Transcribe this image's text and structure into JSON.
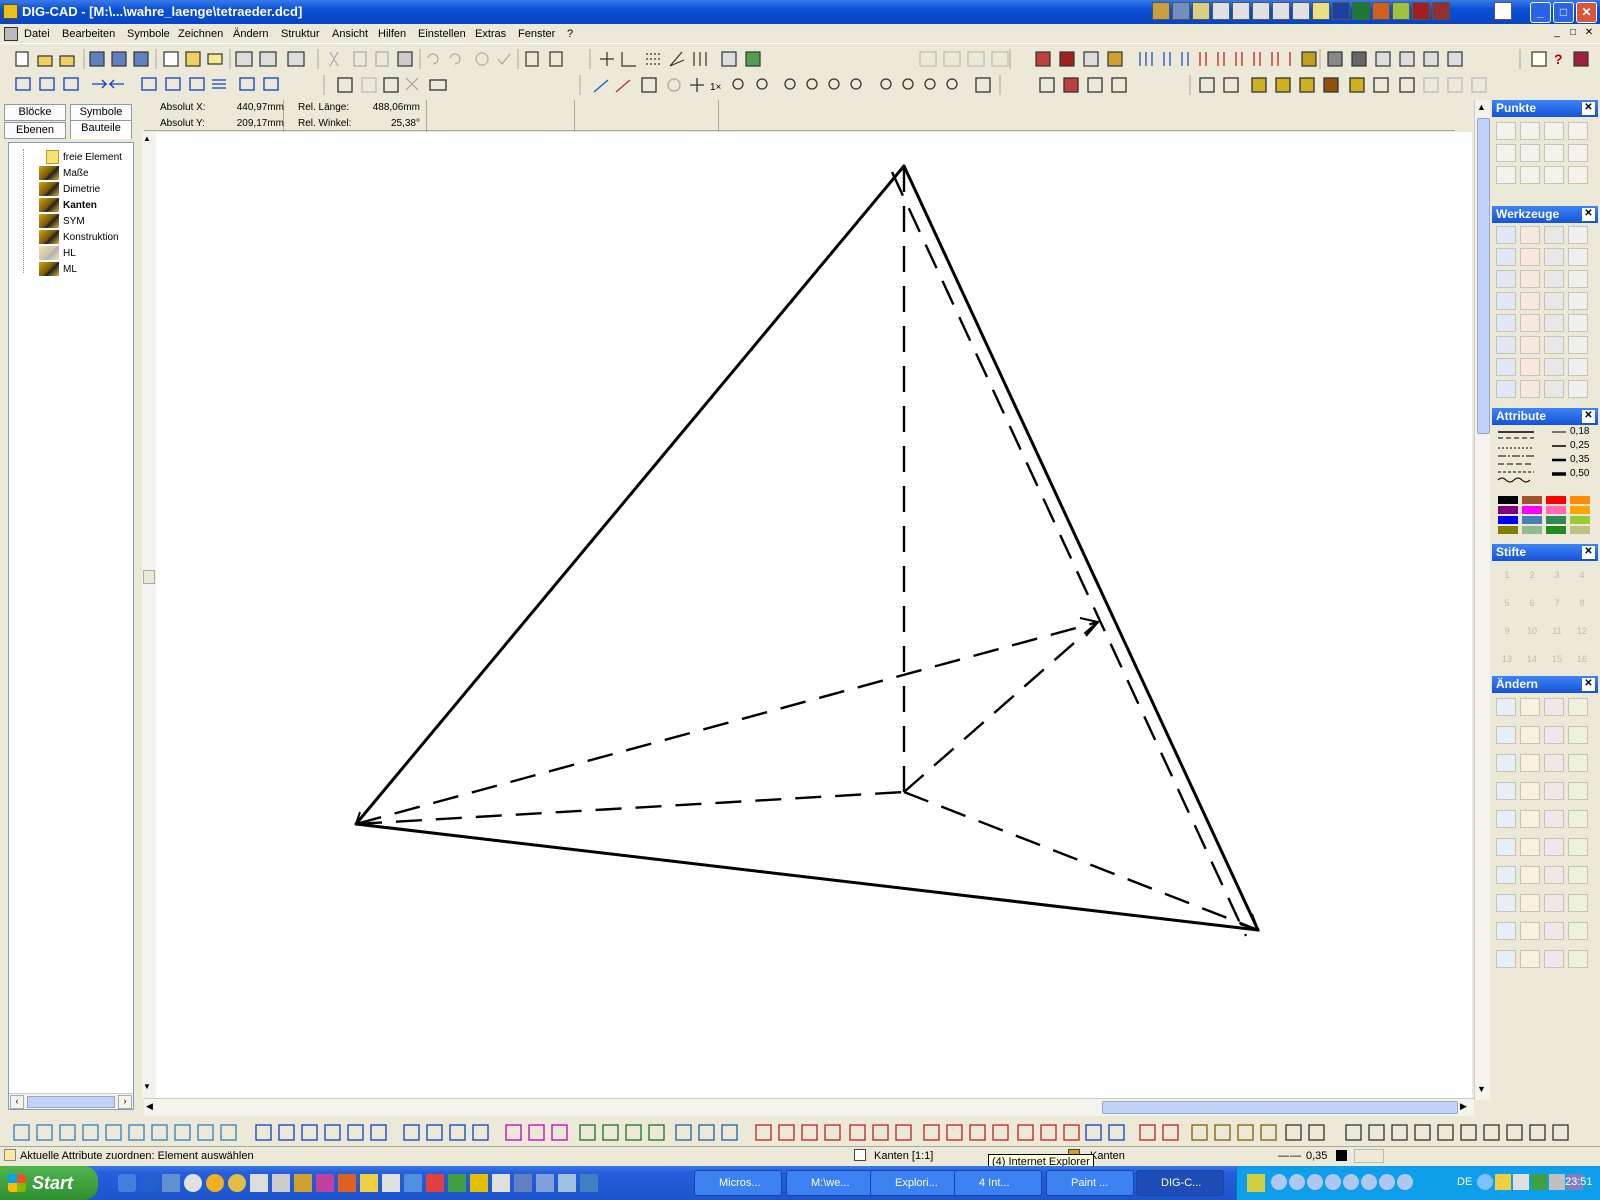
{
  "window": {
    "title": "DIG-CAD - [M:\\...\\wahre_laenge\\tetraeder.dcd]",
    "min": "_",
    "max": "□",
    "close": "✕"
  },
  "menu": [
    "Datei",
    "Bearbeiten",
    "Symbole",
    "Zeichnen",
    "Ändern",
    "Struktur",
    "Ansicht",
    "Hilfen",
    "Einstellen",
    "Extras",
    "Fenster",
    "?"
  ],
  "mdi_controls": [
    "_",
    "□",
    "✕"
  ],
  "left": {
    "tabs": [
      "Blöcke",
      "Symbole",
      "Ebenen",
      "Bauteile"
    ],
    "tree": [
      {
        "label": "freie Element",
        "icon": "folder-icon",
        "bold": false,
        "dim": false
      },
      {
        "label": "Maße",
        "icon": "layer-icon",
        "bold": false,
        "dim": false
      },
      {
        "label": "Dimetrie",
        "icon": "layer-icon",
        "bold": false,
        "dim": false
      },
      {
        "label": "Kanten",
        "icon": "layer-icon",
        "bold": true,
        "dim": false
      },
      {
        "label": "SYM",
        "icon": "layer-icon",
        "bold": false,
        "dim": false
      },
      {
        "label": "Konstruktion",
        "icon": "layer-icon",
        "bold": false,
        "dim": false
      },
      {
        "label": "HL",
        "icon": "layer-icon",
        "bold": false,
        "dim": true
      },
      {
        "label": "ML",
        "icon": "layer-icon",
        "bold": false,
        "dim": false
      }
    ]
  },
  "coords": {
    "abs_x_label": "Absolut X:",
    "abs_x": "440,97mm",
    "abs_y_label": "Absolut Y:",
    "abs_y": "209,17mm",
    "rel_len_label": "Rel. Länge:",
    "rel_len": "488,06mm",
    "rel_ang_label": "Rel. Winkel:",
    "rel_ang": "25,38°"
  },
  "palettes": {
    "punkte": "Punkte",
    "werkzeuge": "Werkzeuge",
    "attribute": "Attribute",
    "stifte": "Stifte",
    "aendern": "Ändern",
    "line_widths": [
      "0,18",
      "0,25",
      "0,35",
      "0,50"
    ],
    "colors": [
      "#000000",
      "#a0522d",
      "#ff0000",
      "#ff8c00",
      "#800080",
      "#ff00ff",
      "#ff69b4",
      "#ffa500",
      "#0000ff",
      "#4682b4",
      "#2e8b57",
      "#9acd32",
      "#808000",
      "#8fbc8f",
      "#228b22",
      "#c0c080"
    ],
    "pens": [
      "1",
      "2",
      "3",
      "4",
      "5",
      "6",
      "7",
      "8",
      "9",
      "10",
      "11",
      "12",
      "13",
      "14",
      "15",
      "16"
    ]
  },
  "status": {
    "hint": "Aktuelle Attribute zuordnen: Element auswählen",
    "layer": "Kanten [1:1]",
    "layer2": "Kanten",
    "linewidth": "0,35",
    "tooltip": "(4) Internet Explorer"
  },
  "taskbar": {
    "start": "Start",
    "tasks": [
      "Micros...",
      "M:\\we...",
      "Explori...",
      "4 Int...",
      "Paint ...",
      "DIG-C..."
    ],
    "lang": "DE",
    "clock": "23:51"
  },
  "drawing": {
    "solid_edges": "4 visible edges",
    "dashed_edges": "6 hidden lines"
  }
}
